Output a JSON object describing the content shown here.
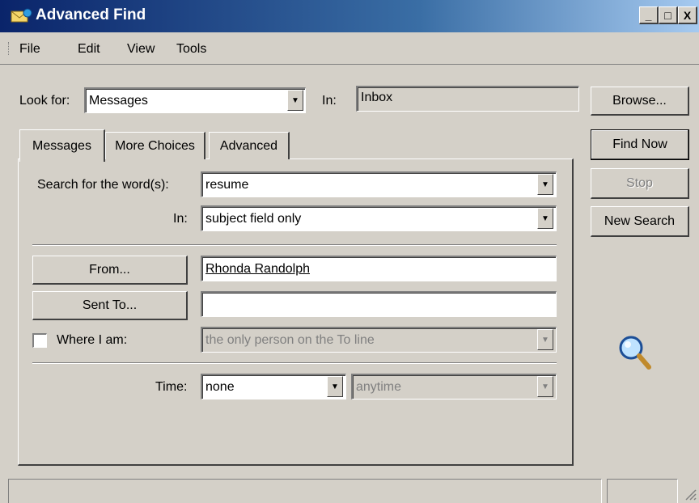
{
  "window": {
    "title": "Advanced Find"
  },
  "titlebar_buttons": {
    "minimize": "_",
    "maximize": "□",
    "close": "X"
  },
  "menu": {
    "items": [
      "File",
      "Edit",
      "View",
      "Tools"
    ]
  },
  "look_for": {
    "label": "Look for:",
    "value": "Messages"
  },
  "in_folder": {
    "label": "In:",
    "value": "Inbox"
  },
  "buttons": {
    "browse": "Browse...",
    "find_now": "Find Now",
    "stop": "Stop",
    "new_search": "New Search"
  },
  "tabs": [
    {
      "label": "Messages",
      "active": true
    },
    {
      "label": "More Choices",
      "active": false
    },
    {
      "label": "Advanced",
      "active": false
    }
  ],
  "search": {
    "label": "Search for the word(s):",
    "value": "resume"
  },
  "in_field": {
    "label": "In:",
    "value": "subject field only"
  },
  "from": {
    "button": "From...",
    "value": "Rhonda Randolph"
  },
  "sent_to": {
    "button": "Sent To...",
    "value": ""
  },
  "where_i_am": {
    "label": "Where I am:",
    "checked": false,
    "value": "the only person on the To line"
  },
  "time": {
    "label": "Time:",
    "value": "none",
    "range": "anytime"
  },
  "icons": {
    "dropdown": "▼",
    "search": "magnifier-icon"
  }
}
